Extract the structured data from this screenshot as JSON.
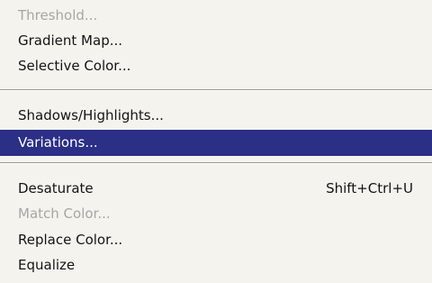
{
  "menu": {
    "group1": [
      {
        "label": "Threshold...",
        "enabled": false
      },
      {
        "label": "Gradient Map...",
        "enabled": true
      },
      {
        "label": "Selective Color...",
        "enabled": true
      }
    ],
    "group2": [
      {
        "label": "Shadows/Highlights...",
        "enabled": true
      },
      {
        "label": "Variations...",
        "enabled": true,
        "selected": true
      }
    ],
    "group3": [
      {
        "label": "Desaturate",
        "shortcut": "Shift+Ctrl+U",
        "enabled": true
      },
      {
        "label": "Match Color...",
        "enabled": false
      },
      {
        "label": "Replace Color...",
        "enabled": true
      },
      {
        "label": "Equalize",
        "enabled": true
      }
    ]
  },
  "colors": {
    "background": "#f4f3ee",
    "highlight": "#2b2f86",
    "text": "#141414",
    "disabled_text": "#a8a6a2"
  }
}
